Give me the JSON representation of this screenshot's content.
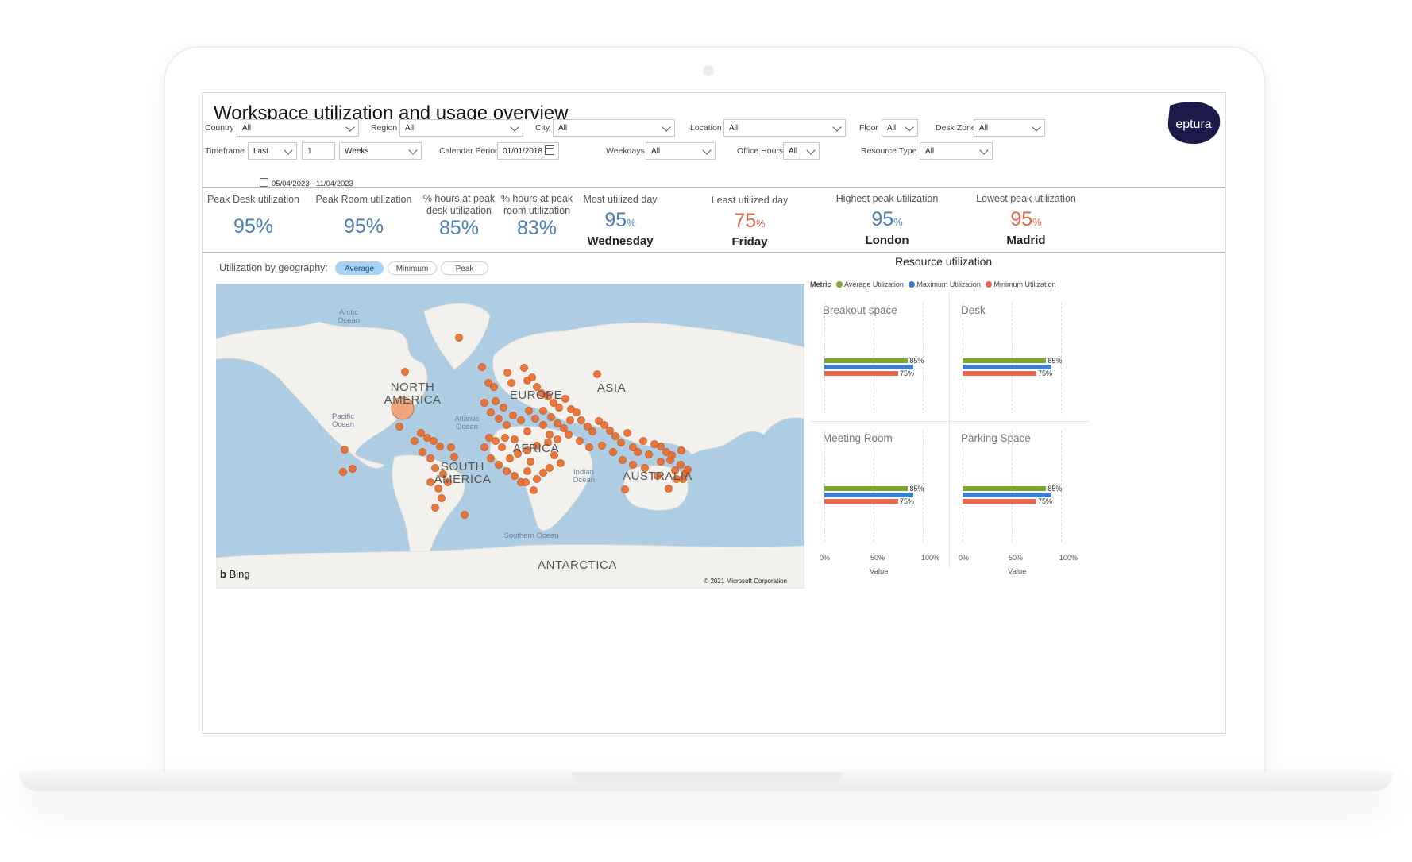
{
  "header": {
    "title": "Workspace utilization and usage overview",
    "logo_text": "eptura"
  },
  "filters": {
    "country": {
      "label": "Country",
      "value": "All"
    },
    "region": {
      "label": "Region",
      "value": "All"
    },
    "city": {
      "label": "City",
      "value": "All"
    },
    "location": {
      "label": "Location",
      "value": "All"
    },
    "floor": {
      "label": "Floor",
      "value": "All"
    },
    "desk_zone": {
      "label": "Desk Zone",
      "value": "All"
    },
    "timeframe": {
      "label": "Timeframe",
      "mode": "Last",
      "count": "1",
      "unit": "Weeks",
      "range": "05/04/2023 - 11/04/2023"
    },
    "calendar_period": {
      "label": "Calendar Period",
      "value": "01/01/2018"
    },
    "weekdays": {
      "label": "Weekdays",
      "value": "All"
    },
    "office_hours": {
      "label": "Office Hours",
      "value": "All"
    },
    "resource_type": {
      "label": "Resource Type",
      "value": "All"
    }
  },
  "kpis": [
    {
      "label": "Peak Desk utilization",
      "value": "95%"
    },
    {
      "label": "Peak Room utilization",
      "value": "95%"
    },
    {
      "label": "% hours at peak desk utilization",
      "value": "85%"
    },
    {
      "label": "% hours at peak room utilization",
      "value": "83%"
    },
    {
      "label": "Most utilized day",
      "value": "95",
      "unit": "%",
      "sub": "Wednesday"
    },
    {
      "label": "Least utilized day",
      "value": "75",
      "unit": "%",
      "sub": "Friday"
    },
    {
      "label": "Highest peak utilization",
      "value": "95",
      "unit": "%",
      "sub": "London"
    },
    {
      "label": "Lowest peak utilization",
      "value": "95",
      "unit": "%",
      "sub": "Madrid"
    }
  ],
  "colors": {
    "blue_value": "#4a7fb5",
    "red_value": "#e2674a",
    "average": "#7fa72e",
    "maximum": "#3f7fc8",
    "minimum": "#e8684f",
    "map_water": "#aecde3",
    "map_land": "#f2f1ee",
    "marker": "#e86a2b"
  },
  "geography": {
    "label": "Utilization by geography:",
    "toggles": [
      {
        "label": "Average",
        "active": true
      },
      {
        "label": "Minimum",
        "active": false
      },
      {
        "label": "Peak",
        "active": false
      }
    ],
    "map_labels": {
      "arctic": "Arctic\nOcean",
      "pacific": "Pacific\nOcean",
      "atlantic": "Atlantic\nOcean",
      "indian": "Indian\nOcean",
      "southern": "Southern Ocean",
      "north_america": "NORTH\nAMERICA",
      "south_america": "SOUTH\nAMERICA",
      "europe": "EUROPE",
      "africa": "AFRICA",
      "asia": "ASIA",
      "australia": "AUSTRALIA",
      "antarctica": "ANTARCTICA"
    },
    "bing": "Bing",
    "copyright": "© 2021 Microsoft Corporation"
  },
  "resource": {
    "title": "Resource utilization",
    "legend_title": "Metric",
    "legend": [
      "Average Utilization",
      "Maximum Utilization",
      "Minimum Utilization"
    ],
    "x_ticks": [
      "0%",
      "50%",
      "100%"
    ],
    "x_title": "Value"
  },
  "chart_data": {
    "type": "bar",
    "title": "Resource utilization",
    "xlabel": "Value",
    "xlim": [
      0,
      100
    ],
    "panels": [
      {
        "name": "Breakout space",
        "series": [
          {
            "name": "Average Utilization",
            "value": 85
          },
          {
            "name": "Maximum Utilization",
            "value": 90
          },
          {
            "name": "Minimum Utilization",
            "value": 75
          }
        ]
      },
      {
        "name": "Desk",
        "series": [
          {
            "name": "Average Utilization",
            "value": 85
          },
          {
            "name": "Maximum Utilization",
            "value": 90
          },
          {
            "name": "Minimum Utilization",
            "value": 75
          }
        ]
      },
      {
        "name": "Meeting Room",
        "series": [
          {
            "name": "Average Utilization",
            "value": 85
          },
          {
            "name": "Maximum Utilization",
            "value": 90
          },
          {
            "name": "Minimum Utilization",
            "value": 75
          }
        ]
      },
      {
        "name": "Parking Space",
        "series": [
          {
            "name": "Average Utilization",
            "value": 85
          },
          {
            "name": "Maximum Utilization",
            "value": 90
          },
          {
            "name": "Minimum Utilization",
            "value": 75
          }
        ]
      }
    ],
    "labels": {
      "average": "85%",
      "minimum": "75%"
    }
  }
}
